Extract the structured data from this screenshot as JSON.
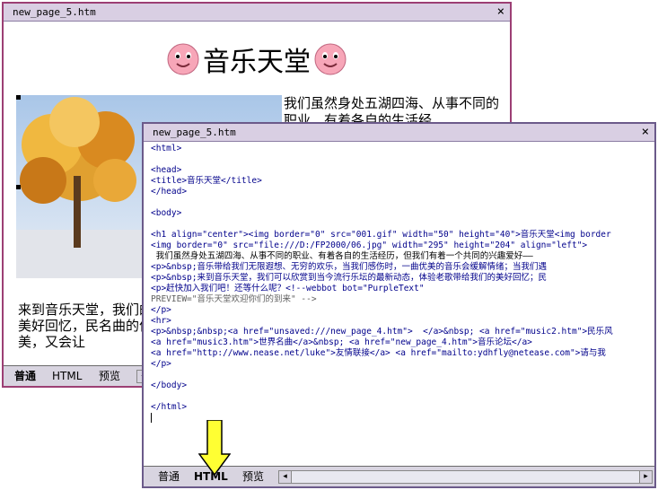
{
  "back_window": {
    "title": "new_page_5.htm",
    "close_glyph": "×",
    "heading": "音乐天堂",
    "right_text": "我们虽然身处五湖四海、从事不同的职业、有着各自的生活经",
    "bottom_text": "来到音乐天堂，我们的美好回忆，民名曲的优美，又会让",
    "tabs": [
      "普通",
      "HTML",
      "预览"
    ],
    "scroll_left": "◂"
  },
  "front_window": {
    "title": "new_page_5.htm",
    "close_glyph": "×",
    "code_lines": [
      "<html>",
      "",
      "<head>",
      "<title>音乐天堂</title>",
      "</head>",
      "",
      "<body>",
      "",
      "<h1 align=\"center\"><img border=\"0\" src=\"001.gif\" width=\"50\" height=\"40\">音乐天堂<img border",
      "<img border=\"0\" src=\"file:///D:/FP2000/06.jpg\" width=\"295\" height=\"204\" align=\"left\">",
      " 我们虽然身处五湖四海、从事不同的职业、有着各自的生活经历，但我们有着一个共同的兴趣爱好——",
      "<p>&nbsp;音乐带给我们无限遐想、无穷的欢乐，当我们感伤时，一曲优美的音乐会缓解情绪；当我们遇",
      "<p>&nbsp;来到音乐天堂，我们可以欣赏到当今流行乐坛的最新动态，体验老歌带给我们的美好回忆；民",
      "<p>赶快加入我们吧！还等什么呢？<!--webbot bot=\"PurpleText\"",
      "PREVIEW=\"音乐天堂欢迎你们的到来\" -->",
      "</p>",
      "<hr>",
      "<p>&nbsp;&nbsp;<a href=\"unsaved:///new_page_4.htm\">  </a>&nbsp; <a href=\"music2.htm\">民乐风",
      "<a href=\"music3.htm\">世界名曲</a>&nbsp; <a href=\"new_page_4.htm\">音乐论坛</a>",
      "<a href=\"http://www.nease.net/luke\">友情联接</a> <a href=\"mailto:ydhfly@netease.com\">请与我",
      "</p>",
      "",
      "</body>",
      "",
      "</html>"
    ],
    "tabs": [
      "普通",
      "HTML",
      "预览"
    ],
    "scroll_left": "◂",
    "scroll_right": "▸"
  },
  "colors": {
    "titlebar": "#d9cfe3",
    "window_border": "#9c3f74",
    "code_tag": "#00008b",
    "arrow_fill": "#ffff33"
  },
  "icons": [
    "smiley-icon",
    "close-icon",
    "yellow-arrow-icon",
    "scroll-left-icon",
    "scroll-right-icon"
  ]
}
